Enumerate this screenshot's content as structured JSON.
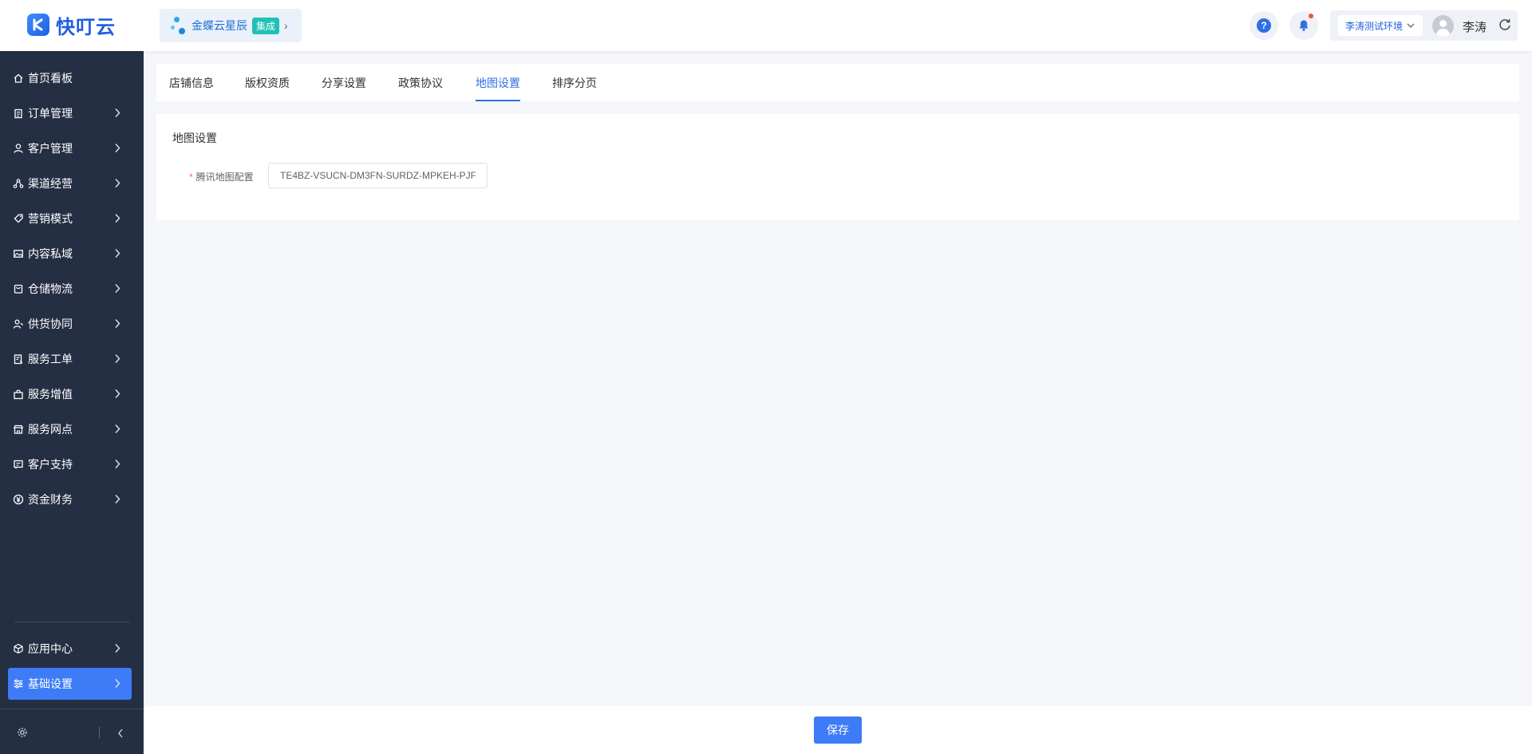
{
  "header": {
    "logo_text": "快叮云",
    "brand": {
      "name": "金蝶云星辰",
      "tag": "集成"
    },
    "help_glyph": "?",
    "environment": "李涛测试环境",
    "user_name": "李涛",
    "colors": {
      "brand_blue": "#1f5fe0",
      "accent": "#3d7bf7",
      "notify_dot": "#f5522d",
      "tag_teal": "#1fc1b6"
    }
  },
  "sidebar": {
    "items": [
      {
        "label": "首页看板",
        "icon": "home-icon"
      },
      {
        "label": "订单管理",
        "icon": "clipboard-icon"
      },
      {
        "label": "客户管理",
        "icon": "user-icon"
      },
      {
        "label": "渠道经营",
        "icon": "channel-icon"
      },
      {
        "label": "营销模式",
        "icon": "tag-icon"
      },
      {
        "label": "内容私域",
        "icon": "image-icon"
      },
      {
        "label": "仓储物流",
        "icon": "box-icon"
      },
      {
        "label": "供货协同",
        "icon": "supply-icon"
      },
      {
        "label": "服务工单",
        "icon": "ticket-icon"
      },
      {
        "label": "服务增值",
        "icon": "bag-icon"
      },
      {
        "label": "服务网点",
        "icon": "store-icon"
      },
      {
        "label": "客户支持",
        "icon": "support-icon"
      },
      {
        "label": "资金财务",
        "icon": "yen-icon"
      }
    ],
    "bottom_items": [
      {
        "label": "应用中心",
        "icon": "cube-icon"
      },
      {
        "label": "基础设置",
        "icon": "sliders-icon",
        "active": true
      }
    ],
    "colors": {
      "background": "#252f44",
      "active": "#3d7bf7"
    }
  },
  "tabs": [
    {
      "label": "店铺信息"
    },
    {
      "label": "版权资质"
    },
    {
      "label": "分享设置"
    },
    {
      "label": "政策协议"
    },
    {
      "label": "地图设置",
      "active": true
    },
    {
      "label": "排序分页"
    }
  ],
  "form": {
    "section_title": "地图设置",
    "required_mark": "*",
    "field_label": "腾讯地图配置",
    "field_value": "TE4BZ-VSUCN-DM3FN-SURDZ-MPKEH-PJF"
  },
  "footer": {
    "save_label": "保存"
  }
}
